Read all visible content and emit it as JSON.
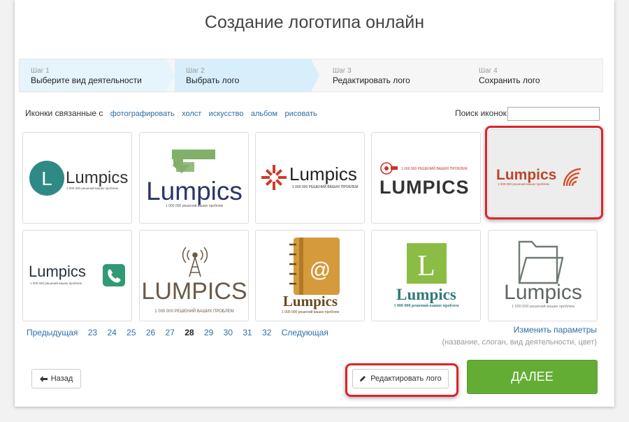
{
  "page": {
    "title": "Создание логотипа онлайн"
  },
  "steps": [
    {
      "num": "Шаг 1",
      "label": "Выберите вид деятельности"
    },
    {
      "num": "Шаг 2",
      "label": "Выбрать лого"
    },
    {
      "num": "Шаг 3",
      "label": "Редактировать лого"
    },
    {
      "num": "Шаг 4",
      "label": "Сохранить лого"
    }
  ],
  "filter": {
    "label": "Иконки связанные с",
    "tags": [
      "фотографировать",
      "холст",
      "искусство",
      "альбом",
      "рисовать"
    ]
  },
  "search": {
    "label": "Поиск иконок:",
    "value": ""
  },
  "logos": [
    {
      "name": "Lumpics",
      "slogan": "1 000 000 решений ваших проблем",
      "initial": "L"
    },
    {
      "name": "Lumpics",
      "slogan": "1 000 000 решений ваших проблем"
    },
    {
      "name": "Lumpics",
      "slogan": "1 000 000 РЕШЕНИЙ ВАШИХ ПРОБЛЕМ"
    },
    {
      "name": "LUMPICS",
      "slogan": "1 000 000 РЕШЕНИЙ ВАШИХ ПРОБЛЕМ"
    },
    {
      "name": "Lumpics",
      "slogan": "1 000 000 решений ваших проблем"
    },
    {
      "name": "Lumpics",
      "slogan": "1 000 000 решений ваших проблем"
    },
    {
      "name": "LUMPICS",
      "slogan": "1 000 000 РЕШЕНИЙ ВАШИХ ПРОБЛЕМ"
    },
    {
      "name": "Lumpics",
      "slogan": "1 000 000 решений ваших проблем",
      "badge": "@"
    },
    {
      "name": "Lumpics",
      "slogan": "1 000 000 решений ваших проблем",
      "initial": "L"
    },
    {
      "name": "Lumpics",
      "slogan": "1 000 000 решений ваших проблем"
    }
  ],
  "pagination": {
    "prev": "Предыдущая",
    "pages": [
      "23",
      "24",
      "25",
      "26",
      "27",
      "28",
      "29",
      "30",
      "31",
      "32"
    ],
    "current": "28",
    "next": "Следующая"
  },
  "change_params": {
    "link": "Изменить параметры",
    "hint": "(название, слоган, вид деятельности, цвет)"
  },
  "buttons": {
    "back": "Назад",
    "edit": "Редактировать лого",
    "next": "ДАЛЕЕ"
  },
  "colors": {
    "accent_green": "#63ad35",
    "highlight_red": "#d9252a",
    "link_blue": "#2a6fa8",
    "teal": "#2f8a85"
  }
}
